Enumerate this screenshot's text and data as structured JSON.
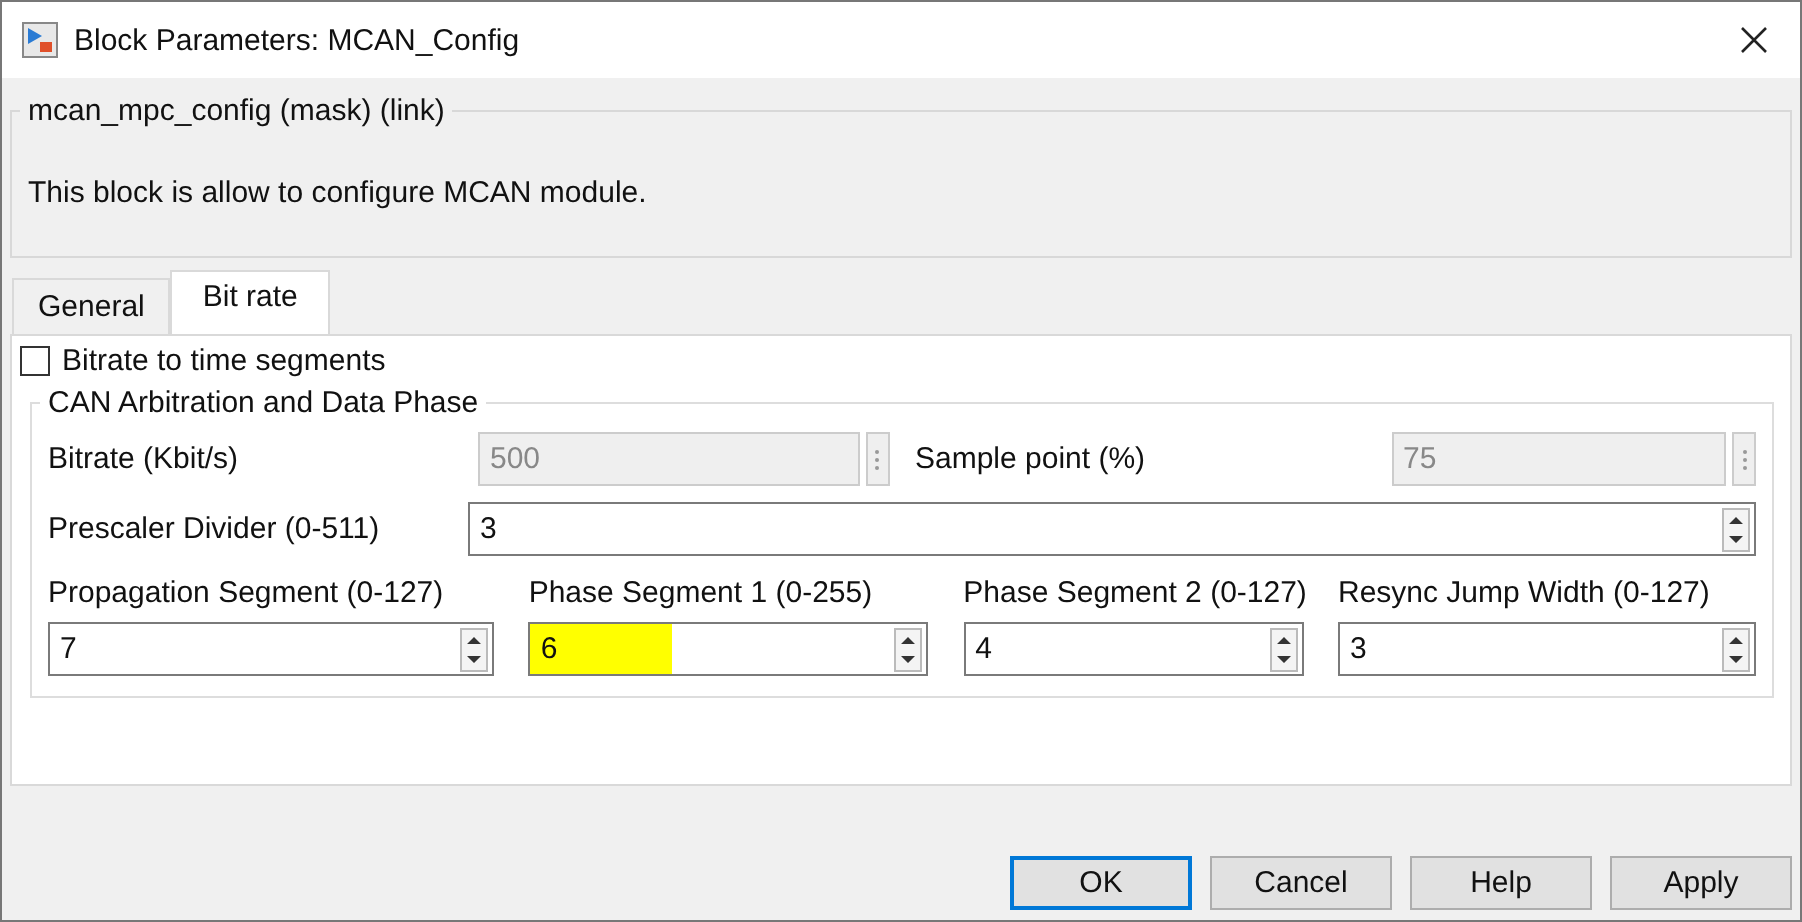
{
  "window": {
    "title": "Block Parameters: MCAN_Config"
  },
  "mask": {
    "title": "mcan_mpc_config (mask) (link)",
    "description": "This block is allow to configure MCAN module."
  },
  "tabs": [
    {
      "label": "General",
      "selected": false
    },
    {
      "label": "Bit rate",
      "selected": true
    }
  ],
  "options": [
    {
      "label": "Bitrate to time segments",
      "checked": false
    }
  ],
  "group": {
    "title": "CAN Arbitration and Data Phase",
    "rows": [
      {
        "kind": "pairs",
        "items": [
          {
            "label": "Bitrate (Kbit/s)",
            "value": "500",
            "disabled": true
          },
          {
            "label": "Sample point (%)",
            "value": "75",
            "disabled": true
          }
        ]
      },
      {
        "kind": "inline",
        "items": [
          {
            "label": "Prescaler Divider (0-511)",
            "value": "3",
            "highlighted": false
          }
        ]
      },
      {
        "kind": "columns",
        "items": [
          {
            "label": "Propagation Segment (0-127)",
            "value": "7",
            "highlighted": false
          },
          {
            "label": "Phase Segment 1 (0-255)",
            "value": "6",
            "highlighted": true
          },
          {
            "label": "Phase Segment 2 (0-127)",
            "value": "4",
            "highlighted": false
          },
          {
            "label": "Resync Jump Width (0-127)",
            "value": "3",
            "highlighted": false
          }
        ]
      }
    ]
  },
  "buttons": [
    {
      "label": "OK",
      "default": true
    },
    {
      "label": "Cancel",
      "default": false
    },
    {
      "label": "Help",
      "default": false
    },
    {
      "label": "Apply",
      "default": false
    }
  ]
}
